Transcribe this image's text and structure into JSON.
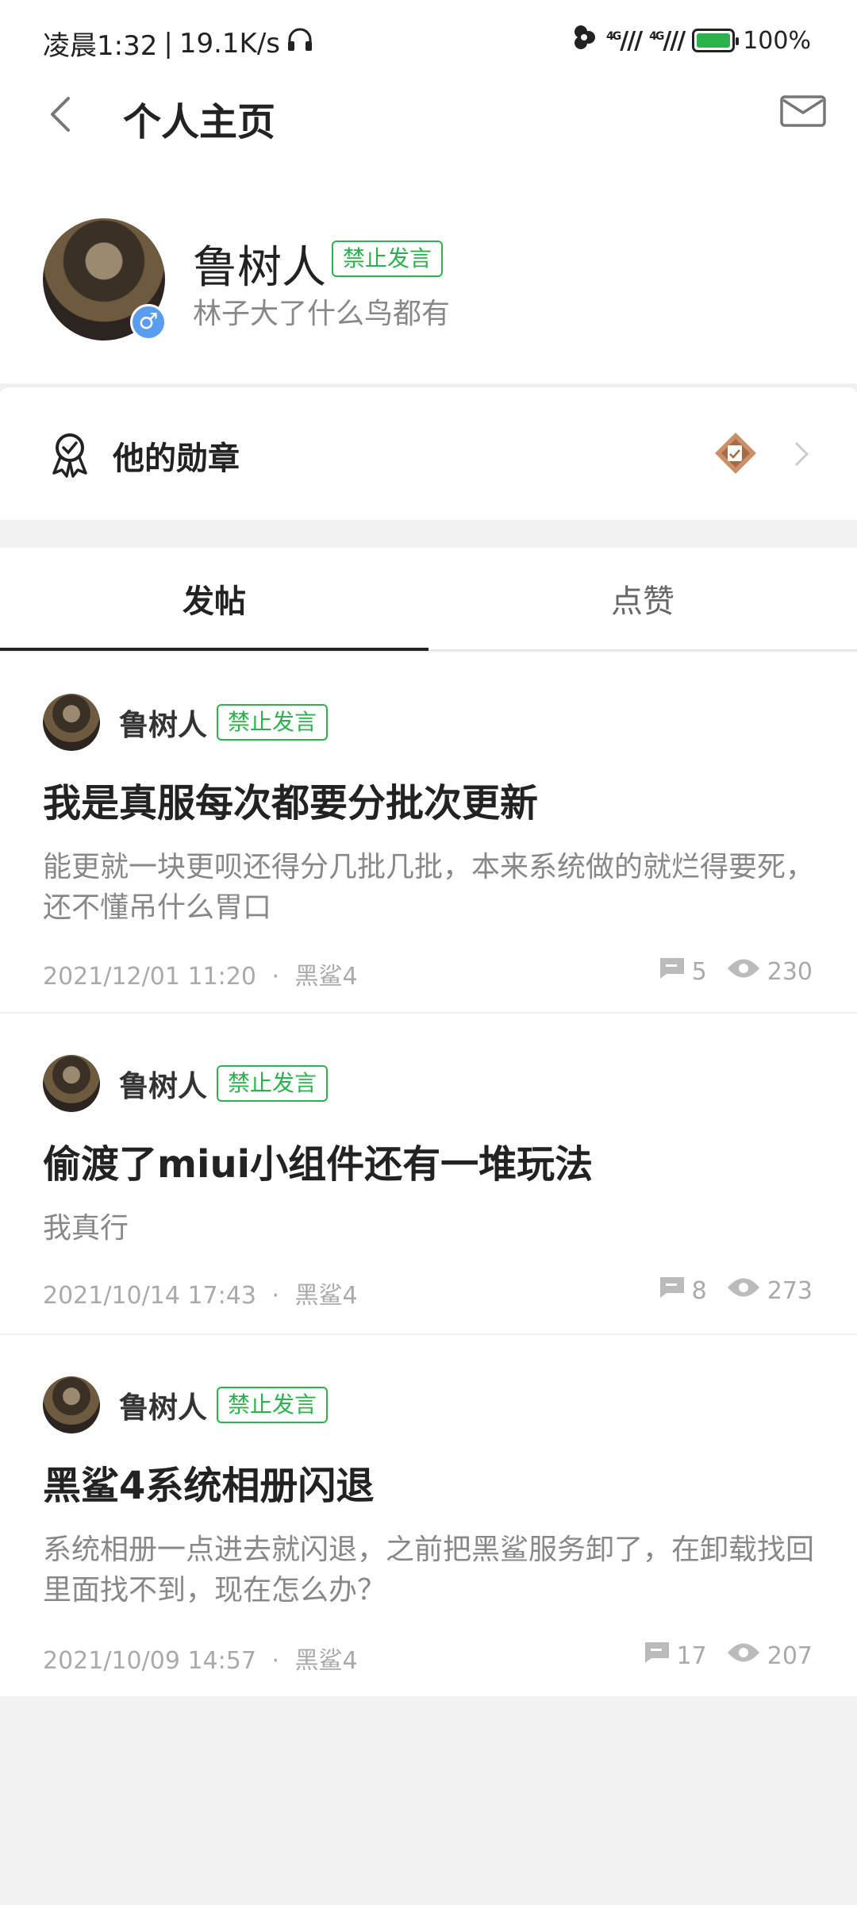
{
  "status_bar": {
    "time": "凌晨1:32",
    "speed": "19.1K/s",
    "network_1": "4G",
    "network_2": "4G",
    "battery": "100%"
  },
  "header": {
    "title": "个人主页",
    "back_icon": "chevron-left-icon",
    "message_icon": "mail-icon"
  },
  "profile": {
    "name": "鲁树人",
    "status_tag": "禁止发言",
    "signature": "林子大了什么鸟都有",
    "gender_symbol": "♂"
  },
  "medals": {
    "label": "他的勋章"
  },
  "tabs": [
    {
      "label": "发帖",
      "active": true
    },
    {
      "label": "点赞",
      "active": false
    }
  ],
  "posts": [
    {
      "author": "鲁树人",
      "tag": "禁止发言",
      "title": "我是真服每次都要分批次更新",
      "excerpt": "能更就一块更呗还得分几批几批，本来系统做的就烂得要死，还不懂吊什么胃口",
      "date": "2021/12/01 11:20",
      "separator": "·",
      "device": "黑鲨4",
      "comments": "5",
      "views": "230"
    },
    {
      "author": "鲁树人",
      "tag": "禁止发言",
      "title": "偷渡了miui小组件还有一堆玩法",
      "excerpt": "我真行",
      "date": "2021/10/14 17:43",
      "separator": "·",
      "device": "黑鲨4",
      "comments": "8",
      "views": "273"
    },
    {
      "author": "鲁树人",
      "tag": "禁止发言",
      "title": "黑鲨4系统相册闪退",
      "excerpt": "系统相册一点进去就闪退，之前把黑鲨服务卸了，在卸载找回里面找不到，现在怎么办？",
      "date": "2021/10/09 14:57",
      "separator": "·",
      "device": "黑鲨4",
      "comments": "17",
      "views": "207"
    }
  ],
  "colors": {
    "accent_green": "#2bb24c",
    "gender_blue": "#5a9cf0",
    "battery_green": "#2ab34a"
  }
}
